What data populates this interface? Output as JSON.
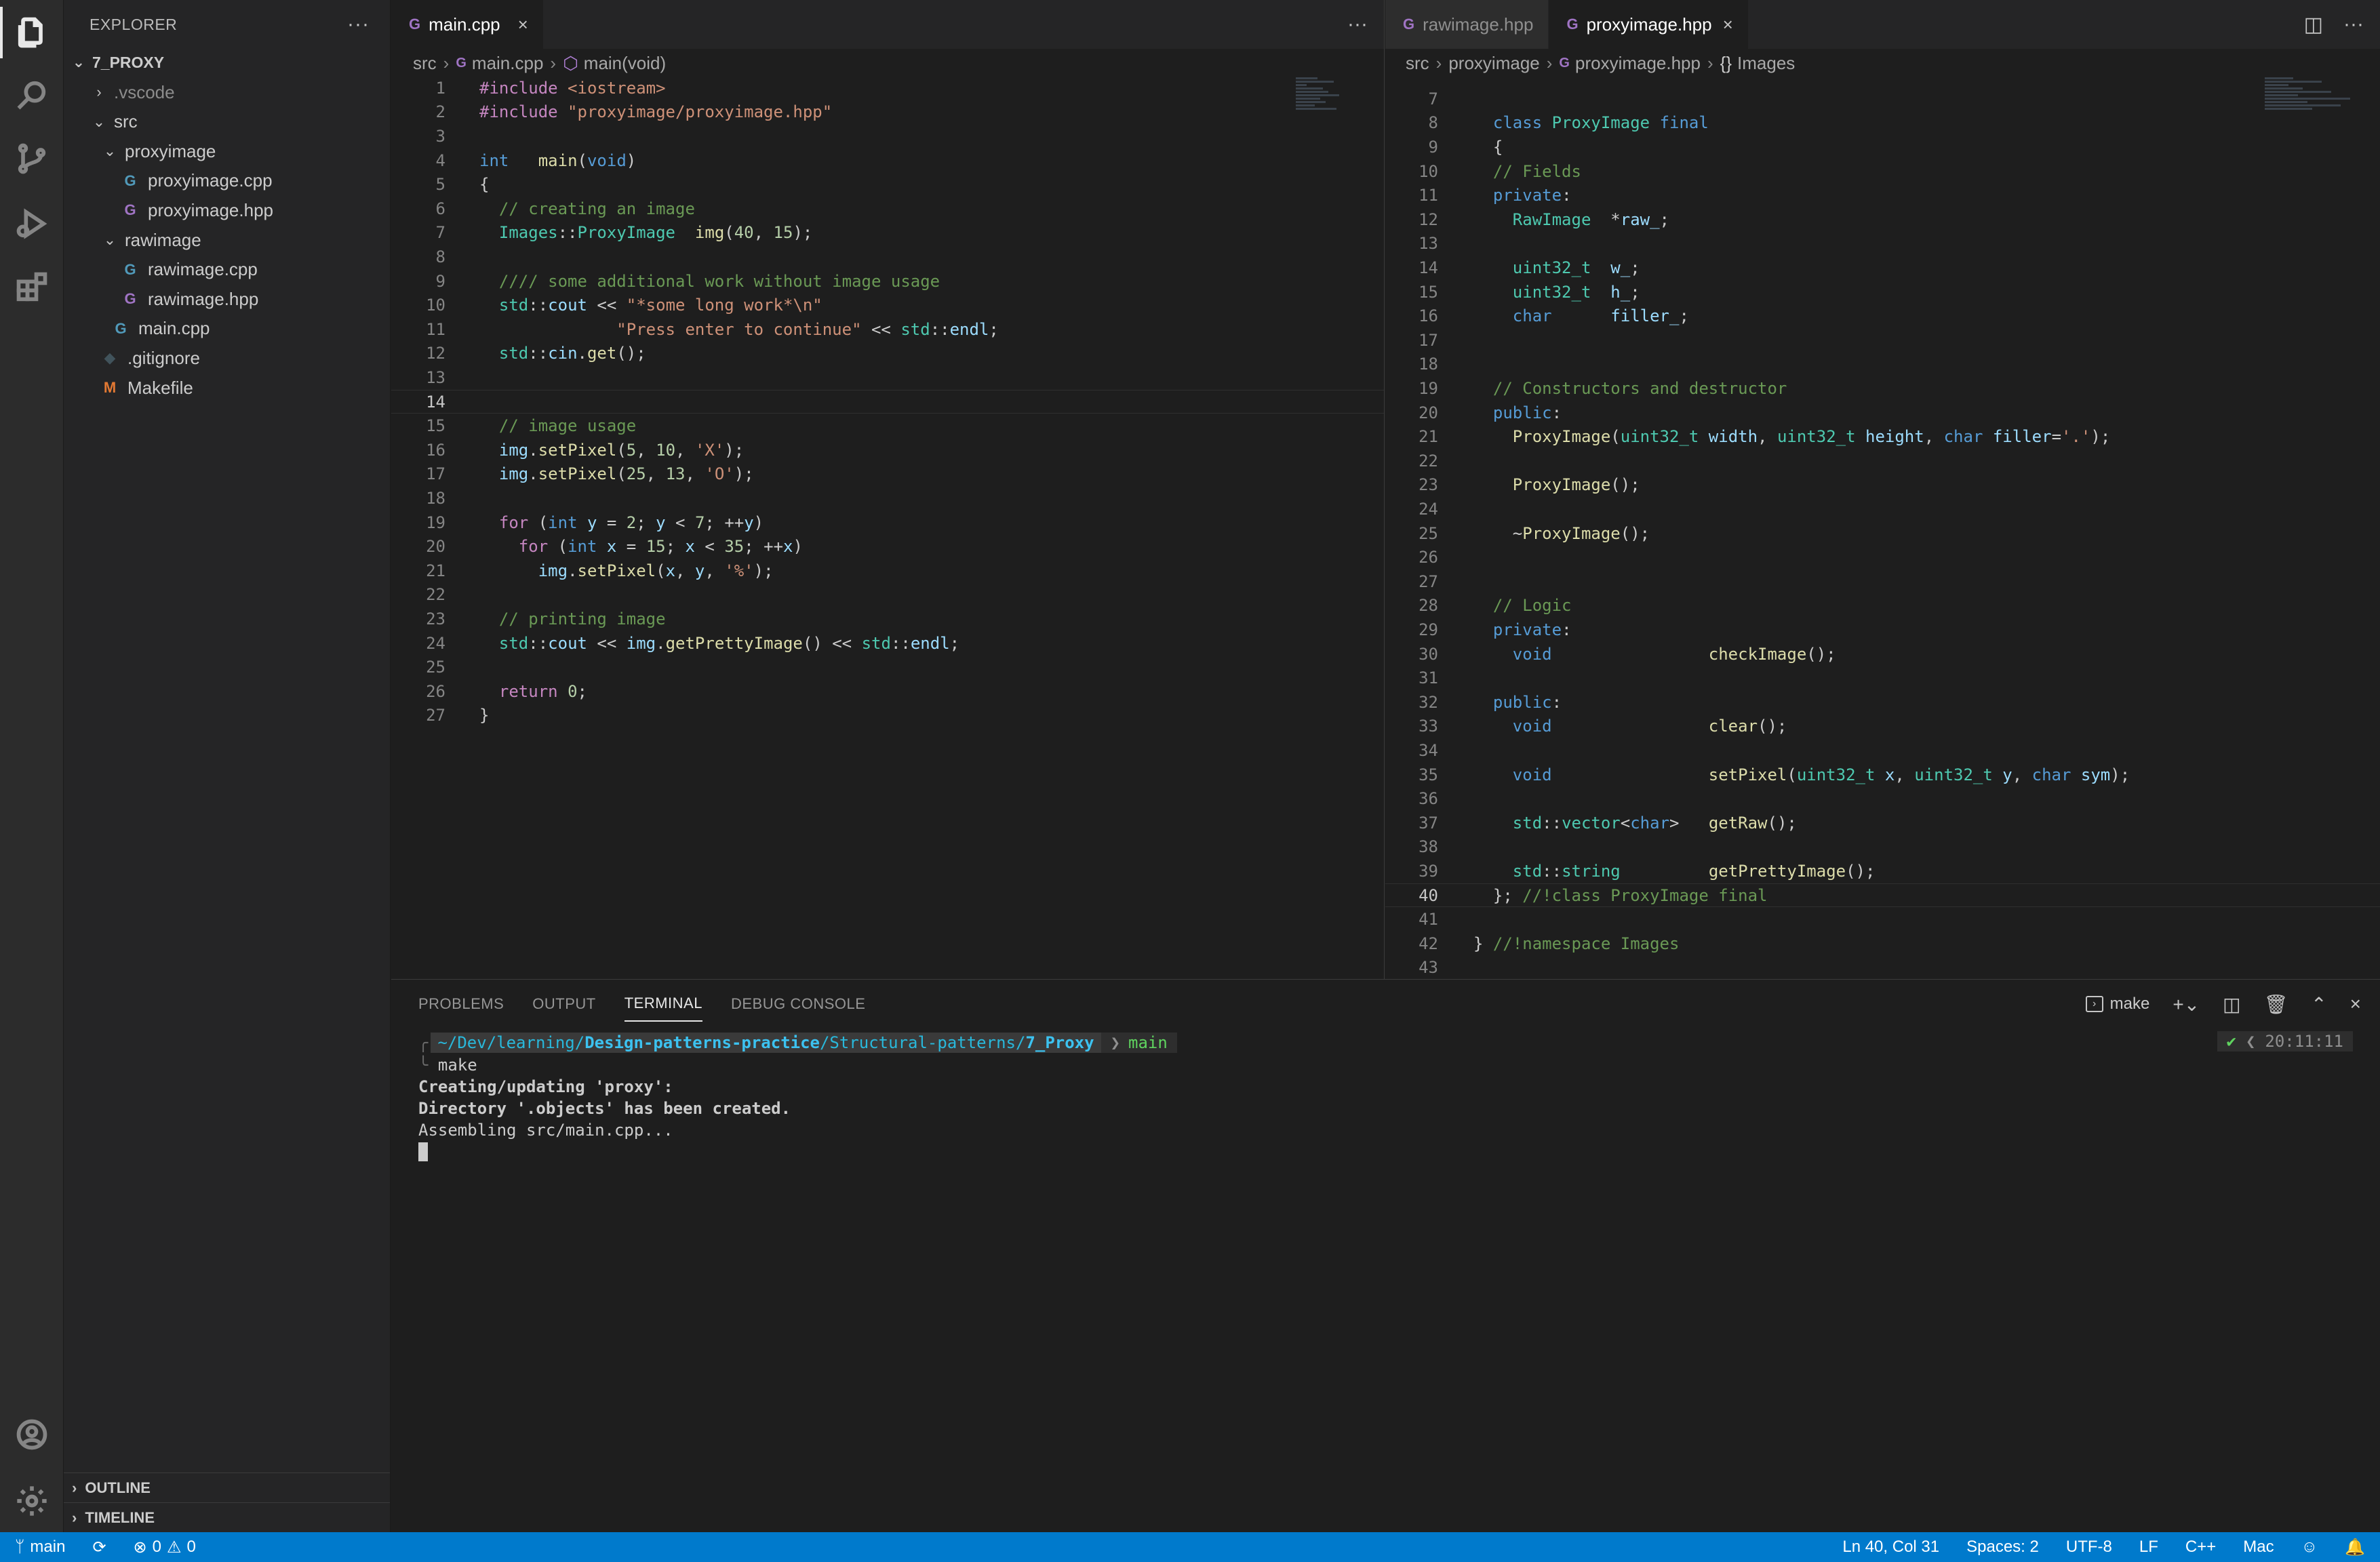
{
  "explorer": {
    "title": "EXPLORER",
    "root": "7_PROXY",
    "items": [
      {
        "label": ".vscode",
        "level": 1,
        "kind": "folder-closed"
      },
      {
        "label": "src",
        "level": 1,
        "kind": "folder-open"
      },
      {
        "label": "proxyimage",
        "level": 2,
        "kind": "folder-open"
      },
      {
        "label": "proxyimage.cpp",
        "level": 3,
        "kind": "cpp"
      },
      {
        "label": "proxyimage.hpp",
        "level": 3,
        "kind": "hpp"
      },
      {
        "label": "rawimage",
        "level": 2,
        "kind": "folder-open"
      },
      {
        "label": "rawimage.cpp",
        "level": 3,
        "kind": "cpp"
      },
      {
        "label": "rawimage.hpp",
        "level": 3,
        "kind": "hpp"
      },
      {
        "label": "main.cpp",
        "level": 2,
        "kind": "cpp"
      },
      {
        "label": ".gitignore",
        "level": 1,
        "kind": "git"
      },
      {
        "label": "Makefile",
        "level": 1,
        "kind": "make"
      }
    ],
    "outline": "OUTLINE",
    "timeline": "TIMELINE"
  },
  "left_editor": {
    "tab": "main.cpp",
    "breadcrumb": [
      "src",
      "main.cpp",
      "main(void)"
    ],
    "lines": [
      {
        "n": "1",
        "code": "#include <iostream>"
      },
      {
        "n": "2",
        "code": "#include \"proxyimage/proxyimage.hpp\""
      },
      {
        "n": "3",
        "code": ""
      },
      {
        "n": "4",
        "code": "int   main(void)"
      },
      {
        "n": "5",
        "code": "{"
      },
      {
        "n": "6",
        "code": "  // creating an image"
      },
      {
        "n": "7",
        "code": "  Images::ProxyImage  img(40, 15);"
      },
      {
        "n": "8",
        "code": ""
      },
      {
        "n": "9",
        "code": "  //// some additional work without image usage"
      },
      {
        "n": "10",
        "code": "  std::cout << \"*some long work*\\n\""
      },
      {
        "n": "11",
        "code": "              \"Press enter to continue\" << std::endl;"
      },
      {
        "n": "12",
        "code": "  std::cin.get();"
      },
      {
        "n": "13",
        "code": ""
      },
      {
        "n": "14",
        "code": ""
      },
      {
        "n": "15",
        "code": "  // image usage"
      },
      {
        "n": "16",
        "code": "  img.setPixel(5, 10, 'X');"
      },
      {
        "n": "17",
        "code": "  img.setPixel(25, 13, 'O');"
      },
      {
        "n": "18",
        "code": ""
      },
      {
        "n": "19",
        "code": "  for (int y = 2; y < 7; ++y)"
      },
      {
        "n": "20",
        "code": "    for (int x = 15; x < 35; ++x)"
      },
      {
        "n": "21",
        "code": "      img.setPixel(x, y, '%');"
      },
      {
        "n": "22",
        "code": ""
      },
      {
        "n": "23",
        "code": "  // printing image"
      },
      {
        "n": "24",
        "code": "  std::cout << img.getPrettyImage() << std::endl;"
      },
      {
        "n": "25",
        "code": ""
      },
      {
        "n": "26",
        "code": "  return 0;"
      },
      {
        "n": "27",
        "code": "}"
      }
    ]
  },
  "right_editor": {
    "tabs": [
      "rawimage.hpp",
      "proxyimage.hpp"
    ],
    "breadcrumb": [
      "src",
      "proxyimage",
      "proxyimage.hpp",
      "Images"
    ],
    "lines": [
      {
        "n": "7",
        "code": ""
      },
      {
        "n": "8",
        "code": "  class ProxyImage final"
      },
      {
        "n": "9",
        "code": "  {"
      },
      {
        "n": "10",
        "code": "  // Fields"
      },
      {
        "n": "11",
        "code": "  private:"
      },
      {
        "n": "12",
        "code": "    RawImage  *raw_;"
      },
      {
        "n": "13",
        "code": ""
      },
      {
        "n": "14",
        "code": "    uint32_t  w_;"
      },
      {
        "n": "15",
        "code": "    uint32_t  h_;"
      },
      {
        "n": "16",
        "code": "    char      filler_;"
      },
      {
        "n": "17",
        "code": ""
      },
      {
        "n": "18",
        "code": ""
      },
      {
        "n": "19",
        "code": "  // Constructors and destructor"
      },
      {
        "n": "20",
        "code": "  public:"
      },
      {
        "n": "21",
        "code": "    ProxyImage(uint32_t width, uint32_t height, char filler='.');"
      },
      {
        "n": "22",
        "code": ""
      },
      {
        "n": "23",
        "code": "    ProxyImage();"
      },
      {
        "n": "24",
        "code": ""
      },
      {
        "n": "25",
        "code": "    ~ProxyImage();"
      },
      {
        "n": "26",
        "code": ""
      },
      {
        "n": "27",
        "code": ""
      },
      {
        "n": "28",
        "code": "  // Logic"
      },
      {
        "n": "29",
        "code": "  private:"
      },
      {
        "n": "30",
        "code": "    void                checkImage();"
      },
      {
        "n": "31",
        "code": ""
      },
      {
        "n": "32",
        "code": "  public:"
      },
      {
        "n": "33",
        "code": "    void                clear();"
      },
      {
        "n": "34",
        "code": ""
      },
      {
        "n": "35",
        "code": "    void                setPixel(uint32_t x, uint32_t y, char sym);"
      },
      {
        "n": "36",
        "code": ""
      },
      {
        "n": "37",
        "code": "    std::vector<char>   getRaw();"
      },
      {
        "n": "38",
        "code": ""
      },
      {
        "n": "39",
        "code": "    std::string         getPrettyImage();"
      },
      {
        "n": "40",
        "code": "  }; //!class ProxyImage final"
      },
      {
        "n": "41",
        "code": ""
      },
      {
        "n": "42",
        "code": "} //!namespace Images"
      },
      {
        "n": "43",
        "code": ""
      }
    ]
  },
  "panel": {
    "tabs": [
      "PROBLEMS",
      "OUTPUT",
      "TERMINAL",
      "DEBUG CONSOLE"
    ],
    "active_tab": "TERMINAL",
    "terminal_name": "make",
    "prompt": {
      "path_prefix": "~/Dev/learning/",
      "path_bold1": "Design-patterns-practice",
      "path_mid": "/Structural-patterns/",
      "path_bold2": "7_Proxy",
      "branch": "main",
      "time": "20:11:11"
    },
    "lines": [
      "make",
      "Creating/updating 'proxy':",
      "Directory '.objects' has been created.",
      "Assembling src/main.cpp..."
    ]
  },
  "status": {
    "branch": "main",
    "errors": "0",
    "warnings": "0",
    "position": "Ln 40, Col 31",
    "spaces": "Spaces: 2",
    "encoding": "UTF-8",
    "eol": "LF",
    "language": "C++",
    "platform": "Mac"
  },
  "colors": {
    "accent": "#007acc",
    "keyword": "#569cd6",
    "comment": "#6a9955",
    "string": "#ce9178",
    "type": "#4ec9b0"
  }
}
